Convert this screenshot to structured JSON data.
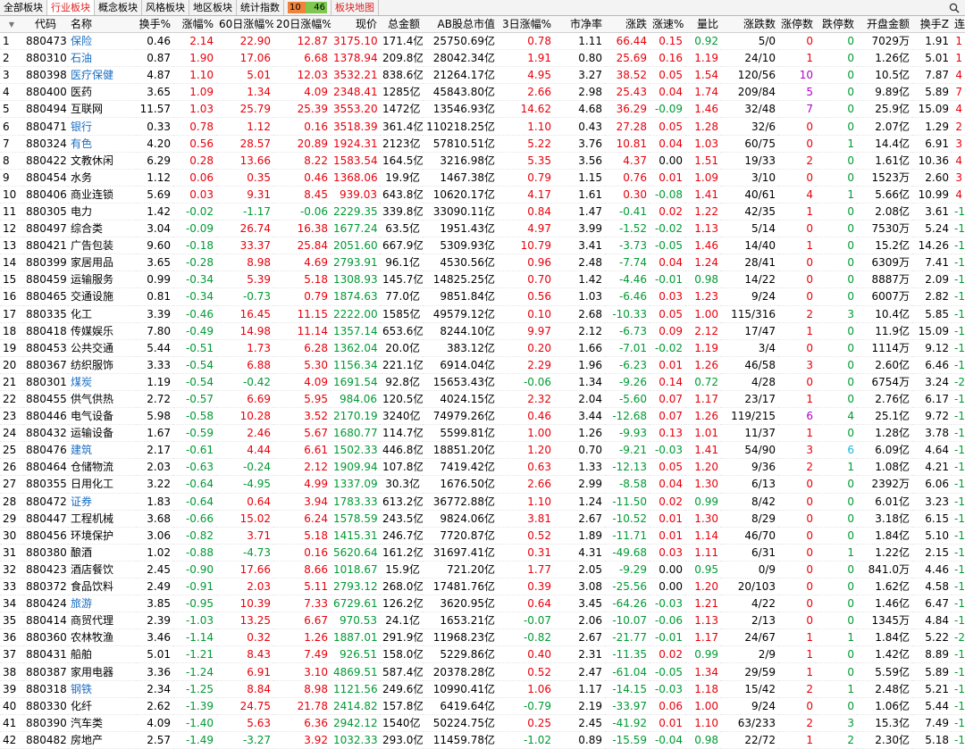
{
  "tabs": [
    {
      "label": "全部板块",
      "active": false
    },
    {
      "label": "行业板块",
      "active": true
    },
    {
      "label": "概念板块",
      "active": false
    },
    {
      "label": "风格板块",
      "active": false
    },
    {
      "label": "地区板块",
      "active": false
    },
    {
      "label": "统计指数",
      "active": false
    }
  ],
  "ratio": {
    "up": "10",
    "down": "46"
  },
  "map_tab": "板块地图",
  "search_icon": "search-icon",
  "headers": [
    "代码",
    "名称",
    "换手%",
    "涨幅%",
    "60日涨幅%",
    "20日涨幅%",
    "现价",
    "总金额",
    "AB股总市值",
    "3日涨幅%",
    "市净率",
    "涨跌",
    "涨速%",
    "量比",
    "涨跌数",
    "涨停数",
    "跌停数",
    "开盘金额",
    "换手Z",
    "连涨天"
  ],
  "rows": [
    {
      "n": "1",
      "code": "880473",
      "name": "保险",
      "link": true,
      "v": [
        "0.46",
        "2.14",
        "22.90",
        "12.87",
        "3175.10",
        "171.4亿",
        "25750.69亿",
        "0.78",
        "1.11",
        "66.44",
        "0.15",
        "0.92",
        "5/0",
        "0",
        "0",
        "7029万",
        "1.91",
        "1"
      ]
    },
    {
      "n": "2",
      "code": "880310",
      "name": "石油",
      "link": true,
      "v": [
        "0.87",
        "1.90",
        "17.06",
        "6.68",
        "1378.94",
        "209.8亿",
        "28042.34亿",
        "1.91",
        "0.80",
        "25.69",
        "0.16",
        "1.19",
        "24/10",
        "1",
        "0",
        "1.26亿",
        "5.01",
        "1"
      ]
    },
    {
      "n": "3",
      "code": "880398",
      "name": "医疗保健",
      "link": true,
      "v": [
        "4.87",
        "1.10",
        "5.01",
        "12.03",
        "3532.21",
        "838.6亿",
        "21264.17亿",
        "4.95",
        "3.27",
        "38.52",
        "0.05",
        "1.54",
        "120/56",
        "10",
        "0",
        "10.5亿",
        "7.87",
        "4"
      ]
    },
    {
      "n": "4",
      "code": "880400",
      "name": "医药",
      "link": false,
      "v": [
        "3.65",
        "1.09",
        "1.34",
        "4.09",
        "2348.41",
        "1285亿",
        "45843.80亿",
        "2.66",
        "2.98",
        "25.43",
        "0.04",
        "1.74",
        "209/84",
        "5",
        "0",
        "9.89亿",
        "5.89",
        "7"
      ]
    },
    {
      "n": "5",
      "code": "880494",
      "name": "互联网",
      "link": false,
      "v": [
        "11.57",
        "1.03",
        "25.79",
        "25.39",
        "3553.20",
        "1472亿",
        "13546.93亿",
        "14.62",
        "4.68",
        "36.29",
        "-0.09",
        "1.46",
        "32/48",
        "7",
        "0",
        "25.9亿",
        "15.09",
        "4"
      ]
    },
    {
      "n": "6",
      "code": "880471",
      "name": "银行",
      "link": true,
      "v": [
        "0.33",
        "0.78",
        "1.12",
        "0.16",
        "3518.39",
        "361.4亿",
        "110218.25亿",
        "1.10",
        "0.43",
        "27.28",
        "0.05",
        "1.28",
        "32/6",
        "0",
        "0",
        "2.07亿",
        "1.29",
        "2"
      ]
    },
    {
      "n": "7",
      "code": "880324",
      "name": "有色",
      "link": true,
      "v": [
        "4.20",
        "0.56",
        "28.57",
        "20.89",
        "1924.31",
        "2123亿",
        "57810.51亿",
        "5.22",
        "3.76",
        "10.81",
        "0.04",
        "1.03",
        "60/75",
        "0",
        "1",
        "14.4亿",
        "6.91",
        "3"
      ]
    },
    {
      "n": "8",
      "code": "880422",
      "name": "文教休闲",
      "link": false,
      "v": [
        "6.29",
        "0.28",
        "13.66",
        "8.22",
        "1583.54",
        "164.5亿",
        "3216.98亿",
        "5.35",
        "3.56",
        "4.37",
        "0.00",
        "1.51",
        "19/33",
        "2",
        "0",
        "1.61亿",
        "10.36",
        "4"
      ]
    },
    {
      "n": "9",
      "code": "880454",
      "name": "水务",
      "link": false,
      "v": [
        "1.12",
        "0.06",
        "0.35",
        "0.46",
        "1368.06",
        "19.9亿",
        "1467.38亿",
        "0.79",
        "1.15",
        "0.76",
        "0.01",
        "1.09",
        "3/10",
        "0",
        "0",
        "1523万",
        "2.60",
        "3"
      ]
    },
    {
      "n": "10",
      "code": "880406",
      "name": "商业连锁",
      "link": false,
      "v": [
        "5.69",
        "0.03",
        "9.31",
        "8.45",
        "939.03",
        "643.8亿",
        "10620.17亿",
        "4.17",
        "1.61",
        "0.30",
        "-0.08",
        "1.41",
        "40/61",
        "4",
        "1",
        "5.66亿",
        "10.99",
        "4"
      ]
    },
    {
      "n": "11",
      "code": "880305",
      "name": "电力",
      "link": false,
      "v": [
        "1.42",
        "-0.02",
        "-1.17",
        "-0.06",
        "2229.35",
        "339.8亿",
        "33090.11亿",
        "0.84",
        "1.47",
        "-0.41",
        "0.02",
        "1.22",
        "42/35",
        "1",
        "0",
        "2.08亿",
        "3.61",
        "-1"
      ]
    },
    {
      "n": "12",
      "code": "880497",
      "name": "综合类",
      "link": false,
      "v": [
        "3.04",
        "-0.09",
        "26.74",
        "16.38",
        "1677.24",
        "63.5亿",
        "1951.43亿",
        "4.97",
        "3.99",
        "-1.52",
        "-0.02",
        "1.13",
        "5/14",
        "0",
        "0",
        "7530万",
        "5.24",
        "-1"
      ]
    },
    {
      "n": "13",
      "code": "880421",
      "name": "广告包装",
      "link": false,
      "v": [
        "9.60",
        "-0.18",
        "33.37",
        "25.84",
        "2051.60",
        "667.9亿",
        "5309.93亿",
        "10.79",
        "3.41",
        "-3.73",
        "-0.05",
        "1.46",
        "14/40",
        "1",
        "0",
        "15.2亿",
        "14.26",
        "-1"
      ]
    },
    {
      "n": "14",
      "code": "880399",
      "name": "家居用品",
      "link": false,
      "v": [
        "3.65",
        "-0.28",
        "8.98",
        "4.69",
        "2793.91",
        "96.1亿",
        "4530.56亿",
        "0.96",
        "2.48",
        "-7.74",
        "0.04",
        "1.24",
        "28/41",
        "0",
        "0",
        "6309万",
        "7.41",
        "-1"
      ]
    },
    {
      "n": "15",
      "code": "880459",
      "name": "运输服务",
      "link": false,
      "v": [
        "0.99",
        "-0.34",
        "5.39",
        "5.18",
        "1308.93",
        "145.7亿",
        "14825.25亿",
        "0.70",
        "1.42",
        "-4.46",
        "-0.01",
        "0.98",
        "14/22",
        "0",
        "0",
        "8887万",
        "2.09",
        "-1"
      ]
    },
    {
      "n": "16",
      "code": "880465",
      "name": "交通设施",
      "link": false,
      "v": [
        "0.81",
        "-0.34",
        "-0.73",
        "0.79",
        "1874.63",
        "77.0亿",
        "9851.84亿",
        "0.56",
        "1.03",
        "-6.46",
        "0.03",
        "1.23",
        "9/24",
        "0",
        "0",
        "6007万",
        "2.82",
        "-1"
      ]
    },
    {
      "n": "17",
      "code": "880335",
      "name": "化工",
      "link": false,
      "v": [
        "3.39",
        "-0.46",
        "16.45",
        "11.15",
        "2222.00",
        "1585亿",
        "49579.12亿",
        "0.10",
        "2.68",
        "-10.33",
        "0.05",
        "1.00",
        "115/316",
        "2",
        "3",
        "10.4亿",
        "5.85",
        "-1"
      ]
    },
    {
      "n": "18",
      "code": "880418",
      "name": "传媒娱乐",
      "link": false,
      "v": [
        "7.80",
        "-0.49",
        "14.98",
        "11.14",
        "1357.14",
        "653.6亿",
        "8244.10亿",
        "9.97",
        "2.12",
        "-6.73",
        "0.09",
        "2.12",
        "17/47",
        "1",
        "0",
        "11.9亿",
        "15.09",
        "-1"
      ]
    },
    {
      "n": "19",
      "code": "880453",
      "name": "公共交通",
      "link": false,
      "v": [
        "5.44",
        "-0.51",
        "1.73",
        "6.28",
        "1362.04",
        "20.0亿",
        "383.12亿",
        "0.20",
        "1.66",
        "-7.01",
        "-0.02",
        "1.19",
        "3/4",
        "0",
        "0",
        "1114万",
        "9.12",
        "-1"
      ]
    },
    {
      "n": "20",
      "code": "880367",
      "name": "纺织服饰",
      "link": false,
      "v": [
        "3.33",
        "-0.54",
        "6.88",
        "5.30",
        "1156.34",
        "221.1亿",
        "6914.04亿",
        "2.29",
        "1.96",
        "-6.23",
        "0.01",
        "1.26",
        "46/58",
        "3",
        "0",
        "2.60亿",
        "6.46",
        "-1"
      ]
    },
    {
      "n": "21",
      "code": "880301",
      "name": "煤炭",
      "link": true,
      "v": [
        "1.19",
        "-0.54",
        "-0.42",
        "4.09",
        "1691.54",
        "92.8亿",
        "15653.43亿",
        "-0.06",
        "1.34",
        "-9.26",
        "0.14",
        "0.72",
        "4/28",
        "0",
        "0",
        "6754万",
        "3.24",
        "-2"
      ]
    },
    {
      "n": "22",
      "code": "880455",
      "name": "供气供热",
      "link": false,
      "v": [
        "2.72",
        "-0.57",
        "6.69",
        "5.95",
        "984.06",
        "120.5亿",
        "4024.15亿",
        "2.32",
        "2.04",
        "-5.60",
        "0.07",
        "1.17",
        "23/17",
        "1",
        "0",
        "2.76亿",
        "6.17",
        "-1"
      ]
    },
    {
      "n": "23",
      "code": "880446",
      "name": "电气设备",
      "link": false,
      "v": [
        "5.98",
        "-0.58",
        "10.28",
        "3.52",
        "2170.19",
        "3240亿",
        "74979.26亿",
        "0.46",
        "3.44",
        "-12.68",
        "0.07",
        "1.26",
        "119/215",
        "6",
        "4",
        "25.1亿",
        "9.72",
        "-1"
      ]
    },
    {
      "n": "24",
      "code": "880432",
      "name": "运输设备",
      "link": false,
      "v": [
        "1.67",
        "-0.59",
        "2.46",
        "5.67",
        "1680.77",
        "114.7亿",
        "5599.81亿",
        "1.00",
        "1.26",
        "-9.93",
        "0.13",
        "1.01",
        "11/37",
        "1",
        "0",
        "1.28亿",
        "3.78",
        "-1"
      ]
    },
    {
      "n": "25",
      "code": "880476",
      "name": "建筑",
      "link": true,
      "v": [
        "2.17",
        "-0.61",
        "4.44",
        "6.61",
        "1502.33",
        "446.8亿",
        "18851.20亿",
        "1.20",
        "0.70",
        "-9.21",
        "-0.03",
        "1.41",
        "54/90",
        "3",
        "6",
        "6.09亿",
        "4.64",
        "-1"
      ]
    },
    {
      "n": "26",
      "code": "880464",
      "name": "仓储物流",
      "link": false,
      "v": [
        "2.03",
        "-0.63",
        "-0.24",
        "2.12",
        "1909.94",
        "107.8亿",
        "7419.42亿",
        "0.63",
        "1.33",
        "-12.13",
        "0.05",
        "1.20",
        "9/36",
        "2",
        "1",
        "1.08亿",
        "4.21",
        "-1"
      ]
    },
    {
      "n": "27",
      "code": "880355",
      "name": "日用化工",
      "link": false,
      "v": [
        "3.22",
        "-0.64",
        "-4.95",
        "4.99",
        "1337.09",
        "30.3亿",
        "1676.50亿",
        "2.66",
        "2.99",
        "-8.58",
        "0.04",
        "1.30",
        "6/13",
        "0",
        "0",
        "2392万",
        "6.06",
        "-1"
      ]
    },
    {
      "n": "28",
      "code": "880472",
      "name": "证券",
      "link": true,
      "v": [
        "1.83",
        "-0.64",
        "0.64",
        "3.94",
        "1783.33",
        "613.2亿",
        "36772.88亿",
        "1.10",
        "1.24",
        "-11.50",
        "0.02",
        "0.99",
        "8/42",
        "0",
        "0",
        "6.01亿",
        "3.23",
        "-1"
      ]
    },
    {
      "n": "29",
      "code": "880447",
      "name": "工程机械",
      "link": false,
      "v": [
        "3.68",
        "-0.66",
        "15.02",
        "6.24",
        "1578.59",
        "243.5亿",
        "9824.06亿",
        "3.81",
        "2.67",
        "-10.52",
        "0.01",
        "1.30",
        "8/29",
        "0",
        "0",
        "3.18亿",
        "6.15",
        "-1"
      ]
    },
    {
      "n": "30",
      "code": "880456",
      "name": "环境保护",
      "link": false,
      "v": [
        "3.06",
        "-0.82",
        "3.71",
        "5.18",
        "1415.31",
        "246.7亿",
        "7720.87亿",
        "0.52",
        "1.89",
        "-11.71",
        "0.01",
        "1.14",
        "46/70",
        "0",
        "0",
        "1.84亿",
        "5.10",
        "-1"
      ]
    },
    {
      "n": "31",
      "code": "880380",
      "name": "酿酒",
      "link": false,
      "v": [
        "1.02",
        "-0.88",
        "-4.73",
        "0.16",
        "5620.64",
        "161.2亿",
        "31697.41亿",
        "0.31",
        "4.31",
        "-49.68",
        "0.03",
        "1.11",
        "6/31",
        "0",
        "1",
        "1.22亿",
        "2.15",
        "-1"
      ]
    },
    {
      "n": "32",
      "code": "880423",
      "name": "酒店餐饮",
      "link": false,
      "v": [
        "2.45",
        "-0.90",
        "17.66",
        "8.66",
        "1018.67",
        "15.9亿",
        "721.20亿",
        "1.77",
        "2.05",
        "-9.29",
        "0.00",
        "0.95",
        "0/9",
        "0",
        "0",
        "841.0万",
        "4.46",
        "-1"
      ]
    },
    {
      "n": "33",
      "code": "880372",
      "name": "食品饮料",
      "link": false,
      "v": [
        "2.49",
        "-0.91",
        "2.03",
        "5.11",
        "2793.12",
        "268.0亿",
        "17481.76亿",
        "0.39",
        "3.08",
        "-25.56",
        "0.00",
        "1.20",
        "20/103",
        "0",
        "0",
        "1.62亿",
        "4.58",
        "-1"
      ]
    },
    {
      "n": "34",
      "code": "880424",
      "name": "旅游",
      "link": true,
      "v": [
        "3.85",
        "-0.95",
        "10.39",
        "7.33",
        "6729.61",
        "126.2亿",
        "3620.95亿",
        "0.64",
        "3.45",
        "-64.26",
        "-0.03",
        "1.21",
        "4/22",
        "0",
        "0",
        "1.46亿",
        "6.47",
        "-1"
      ]
    },
    {
      "n": "35",
      "code": "880414",
      "name": "商贸代理",
      "link": false,
      "v": [
        "2.39",
        "-1.03",
        "13.25",
        "6.67",
        "970.53",
        "24.1亿",
        "1653.21亿",
        "-0.07",
        "2.06",
        "-10.07",
        "-0.06",
        "1.13",
        "2/13",
        "0",
        "0",
        "1345万",
        "4.84",
        "-1"
      ]
    },
    {
      "n": "36",
      "code": "880360",
      "name": "农林牧渔",
      "link": false,
      "v": [
        "3.46",
        "-1.14",
        "0.32",
        "1.26",
        "1887.01",
        "291.9亿",
        "11968.23亿",
        "-0.82",
        "2.67",
        "-21.77",
        "-0.01",
        "1.17",
        "24/67",
        "1",
        "1",
        "1.84亿",
        "5.22",
        "-2"
      ]
    },
    {
      "n": "37",
      "code": "880431",
      "name": "船舶",
      "link": false,
      "v": [
        "5.01",
        "-1.21",
        "8.43",
        "7.49",
        "926.51",
        "158.0亿",
        "5229.86亿",
        "0.40",
        "2.31",
        "-11.35",
        "0.02",
        "0.99",
        "2/9",
        "1",
        "0",
        "1.42亿",
        "8.89",
        "-1"
      ]
    },
    {
      "n": "38",
      "code": "880387",
      "name": "家用电器",
      "link": false,
      "v": [
        "3.36",
        "-1.24",
        "6.91",
        "3.10",
        "4869.51",
        "587.4亿",
        "20378.28亿",
        "0.52",
        "2.47",
        "-61.04",
        "-0.05",
        "1.34",
        "29/59",
        "1",
        "0",
        "5.59亿",
        "5.89",
        "-1"
      ]
    },
    {
      "n": "39",
      "code": "880318",
      "name": "钢铁",
      "link": true,
      "v": [
        "2.34",
        "-1.25",
        "8.84",
        "8.98",
        "1121.56",
        "249.6亿",
        "10990.41亿",
        "1.06",
        "1.17",
        "-14.15",
        "-0.03",
        "1.18",
        "15/42",
        "2",
        "1",
        "2.48亿",
        "5.21",
        "-1"
      ]
    },
    {
      "n": "40",
      "code": "880330",
      "name": "化纤",
      "link": false,
      "v": [
        "2.62",
        "-1.39",
        "24.75",
        "21.78",
        "2414.82",
        "157.8亿",
        "6419.64亿",
        "-0.79",
        "2.19",
        "-33.97",
        "0.06",
        "1.00",
        "9/24",
        "0",
        "0",
        "1.06亿",
        "5.44",
        "-1"
      ]
    },
    {
      "n": "41",
      "code": "880390",
      "name": "汽车类",
      "link": false,
      "v": [
        "4.09",
        "-1.40",
        "5.63",
        "6.36",
        "2942.12",
        "1540亿",
        "50224.75亿",
        "0.25",
        "2.45",
        "-41.92",
        "0.01",
        "1.10",
        "63/233",
        "2",
        "3",
        "15.3亿",
        "7.49",
        "-1"
      ]
    },
    {
      "n": "42",
      "code": "880482",
      "name": "房地产",
      "link": false,
      "v": [
        "2.57",
        "-1.49",
        "-3.27",
        "3.92",
        "1032.33",
        "293.0亿",
        "11459.78亿",
        "-1.02",
        "0.89",
        "-15.59",
        "-0.04",
        "0.98",
        "22/72",
        "1",
        "2",
        "2.30亿",
        "5.18",
        "-1"
      ]
    }
  ]
}
